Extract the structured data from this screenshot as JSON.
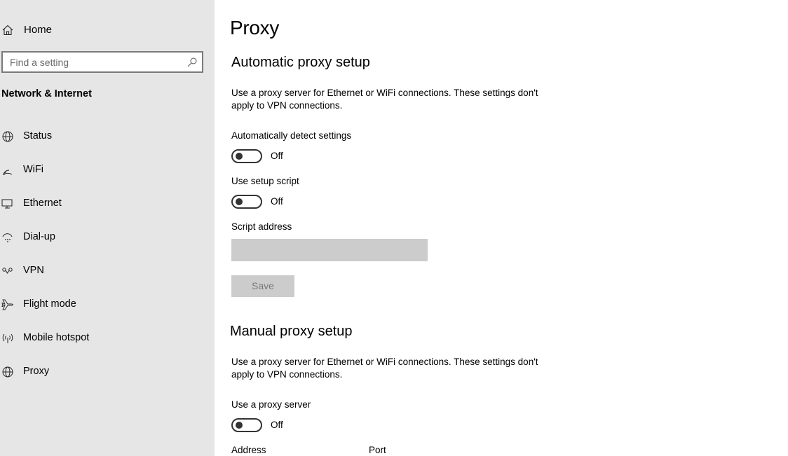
{
  "sidebar": {
    "home_label": "Home",
    "search_placeholder": "Find a setting",
    "section_title": "Network & Internet",
    "items": [
      {
        "label": "Status",
        "icon": "globe-status-icon"
      },
      {
        "label": "WiFi",
        "icon": "wifi-icon"
      },
      {
        "label": "Ethernet",
        "icon": "ethernet-icon"
      },
      {
        "label": "Dial-up",
        "icon": "dialup-icon"
      },
      {
        "label": "VPN",
        "icon": "vpn-icon"
      },
      {
        "label": "Flight mode",
        "icon": "airplane-icon"
      },
      {
        "label": "Mobile hotspot",
        "icon": "hotspot-icon"
      },
      {
        "label": "Proxy",
        "icon": "globe-icon"
      }
    ]
  },
  "main": {
    "page_title": "Proxy",
    "auto": {
      "heading": "Automatic proxy setup",
      "description": "Use a proxy server for Ethernet or WiFi connections. These settings don't apply to VPN connections.",
      "detect_label": "Automatically detect settings",
      "detect_state": "Off",
      "script_label": "Use setup script",
      "script_state": "Off",
      "address_label": "Script address",
      "address_value": "",
      "save_label": "Save"
    },
    "manual": {
      "heading": "Manual proxy setup",
      "description": "Use a proxy server for Ethernet or WiFi connections. These settings don't apply to VPN connections.",
      "proxy_label": "Use a proxy server",
      "proxy_state": "Off",
      "address_label": "Address",
      "port_label": "Port"
    }
  },
  "colors": {
    "sidebar_bg": "#e6e6e6",
    "disabled_bg": "#cccccc",
    "toggle_border": "#333333"
  }
}
